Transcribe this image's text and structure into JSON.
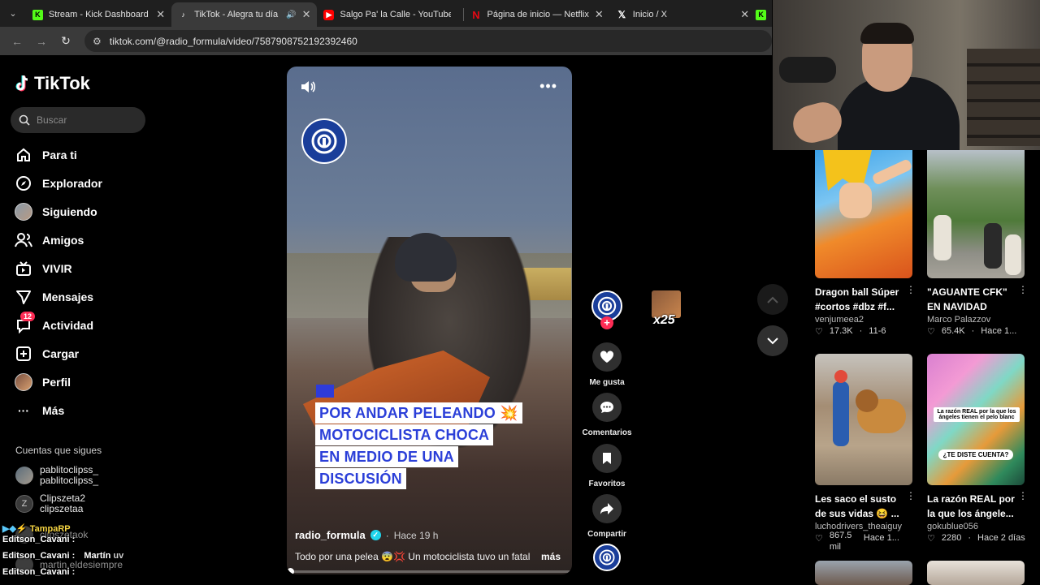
{
  "browser": {
    "tabs": [
      {
        "title": "Stream - Kick Dashboard",
        "favicon": "kick",
        "color": "#53fc18"
      },
      {
        "title": "TikTok - Alegra tu día",
        "favicon": "tiktok",
        "color": "#ffffff"
      },
      {
        "title": "Salgo Pa' la Calle - YouTube",
        "favicon": "youtube",
        "color": "#ff0000"
      },
      {
        "title": "Página de inicio — Netflix",
        "favicon": "netflix",
        "color": "#e50914"
      },
      {
        "title": "Inicio / X",
        "favicon": "x",
        "color": "#ffffff"
      }
    ],
    "url": "tiktok.com/@radio_formula/video/7587908752192392460"
  },
  "sidebar": {
    "logo": "TikTok",
    "search_placeholder": "Buscar",
    "nav": [
      {
        "label": "Para ti",
        "icon": "home-icon"
      },
      {
        "label": "Explorador",
        "icon": "compass-icon"
      },
      {
        "label": "Siguiendo",
        "icon": "avatar-icon"
      },
      {
        "label": "Amigos",
        "icon": "friends-icon"
      },
      {
        "label": "VIVIR",
        "icon": "live-tv-icon"
      },
      {
        "label": "Mensajes",
        "icon": "send-icon"
      },
      {
        "label": "Actividad",
        "icon": "inbox-icon",
        "badge": "12"
      },
      {
        "label": "Cargar",
        "icon": "plus-square-icon"
      },
      {
        "label": "Perfil",
        "icon": "avatar-icon"
      },
      {
        "label": "Más",
        "icon": "ellipsis-icon"
      }
    ],
    "following_title": "Cuentas que sigues",
    "following": [
      {
        "name": "pablitoclipss_",
        "handle": "pablitoclipss_"
      },
      {
        "name": "Clipszeta2",
        "handle": "clipszetaa"
      },
      {
        "name": "",
        "handle": "clipszetaok"
      },
      {
        "name": "",
        "handle": "martin.eldesiempre"
      }
    ]
  },
  "chat": [
    {
      "user": "TampaRP",
      "text": ""
    },
    {
      "user": "Editson_Cavani",
      "text": ":"
    },
    {
      "user": "Editson_Cavani",
      "text": ":"
    },
    {
      "user": "Martín",
      "text": "uv"
    },
    {
      "user": "Editson_Cavani",
      "text": ":"
    }
  ],
  "video": {
    "caption_lines": [
      "POR ANDAR PELEANDO 💥",
      "MOTOCICLISTA CHOCA",
      "EN MEDIO DE UNA",
      "DISCUSIÓN"
    ],
    "author": "radio_formula",
    "time": "Hace 19 h",
    "description": "Todo por una pelea 😨💢 Un motociclista tuvo un fatal",
    "more": "más",
    "progress": 0.0
  },
  "actions": {
    "like": "Me gusta",
    "comments": "Comentarios",
    "favorites": "Favoritos",
    "share": "Compartir"
  },
  "gift": {
    "multiplier": "x25"
  },
  "recommendations": [
    {
      "title": "Dragon ball Súper #cortos #dbz #f...",
      "user": "venjumeea2",
      "views": "17.3K",
      "date": "11-6"
    },
    {
      "title": "\"AGUANTE CFK\" EN NAVIDAD",
      "user": "Marco Palazzov",
      "views": "65.4K",
      "date": "Hace 1..."
    },
    {
      "title": "Les saco el susto de sus vidas 😆 ...",
      "user": "luchodrivers_theaiguy",
      "views": "867.5 mil",
      "date": "Hace 1..."
    },
    {
      "title": "La razón REAL por la que los ángele...",
      "user": "gokublue056",
      "views": "2280",
      "date": "Hace 2 días",
      "overlay": "La razón REAL por la que los ángeles tienen el pelo blanc",
      "overlay2": "¿TE DISTE CUENTA?"
    }
  ]
}
